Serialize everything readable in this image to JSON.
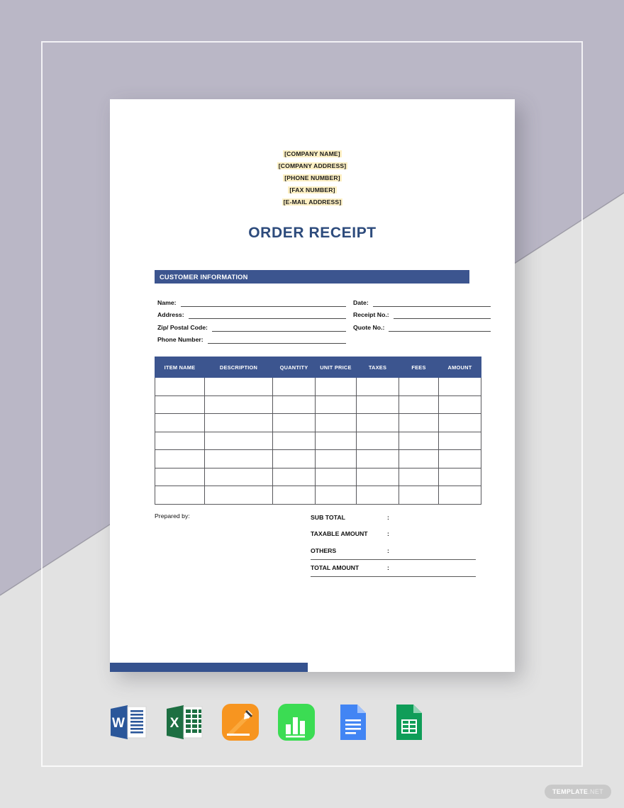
{
  "background": {
    "upper_color": "#bab7c6",
    "lower_color": "#e2e2e2",
    "frame_color": "#ffffff"
  },
  "document": {
    "accent_color": "#3c558f",
    "title_color": "#2d4b7c",
    "highlight_color": "#fdf0c4",
    "letterhead": [
      "[COMPANY NAME]",
      "[COMPANY ADDRESS]",
      "[PHONE NUMBER]",
      "[FAX NUMBER]",
      "[E-MAIL ADDRESS]"
    ],
    "title": "ORDER RECEIPT",
    "section_heading": "CUSTOMER INFORMATION",
    "customer_fields_left": [
      {
        "label": "Name:",
        "value": ""
      },
      {
        "label": "Address:",
        "value": ""
      },
      {
        "label": "Zip/ Postal Code:",
        "value": ""
      },
      {
        "label": "Phone Number:",
        "value": ""
      }
    ],
    "customer_fields_right": [
      {
        "label": "Date:",
        "value": ""
      },
      {
        "label": "Receipt  No.:",
        "value": ""
      },
      {
        "label": "Quote No.:",
        "value": ""
      }
    ],
    "table": {
      "columns": [
        "ITEM NAME",
        "DESCRIPTION",
        "QUANTITY",
        "UNIT PRICE",
        "TAXES",
        "FEES",
        "AMOUNT"
      ],
      "rows": [
        [
          "",
          "",
          "",
          "",
          "",
          "",
          ""
        ],
        [
          "",
          "",
          "",
          "",
          "",
          "",
          ""
        ],
        [
          "",
          "",
          "",
          "",
          "",
          "",
          ""
        ],
        [
          "",
          "",
          "",
          "",
          "",
          "",
          ""
        ],
        [
          "",
          "",
          "",
          "",
          "",
          "",
          ""
        ],
        [
          "",
          "",
          "",
          "",
          "",
          "",
          ""
        ],
        [
          "",
          "",
          "",
          "",
          "",
          "",
          ""
        ]
      ]
    },
    "prepared_by_label": "Prepared by:",
    "totals": [
      {
        "label": "SUB TOTAL",
        "separator": ":",
        "value": ""
      },
      {
        "label": "TAXABLE AMOUNT",
        "separator": ":",
        "value": ""
      },
      {
        "label": "OTHERS",
        "separator": ":",
        "value": ""
      },
      {
        "label": "TOTAL AMOUNT",
        "separator": ":",
        "value": ""
      }
    ]
  },
  "app_icons": [
    {
      "name": "microsoft-word-icon",
      "label": "W"
    },
    {
      "name": "microsoft-excel-icon",
      "label": "X"
    },
    {
      "name": "apple-pages-icon",
      "label": ""
    },
    {
      "name": "apple-numbers-icon",
      "label": ""
    },
    {
      "name": "google-docs-icon",
      "label": ""
    },
    {
      "name": "google-sheets-icon",
      "label": ""
    }
  ],
  "watermark": {
    "strong": "TEMPLATE",
    "light": ".NET"
  }
}
